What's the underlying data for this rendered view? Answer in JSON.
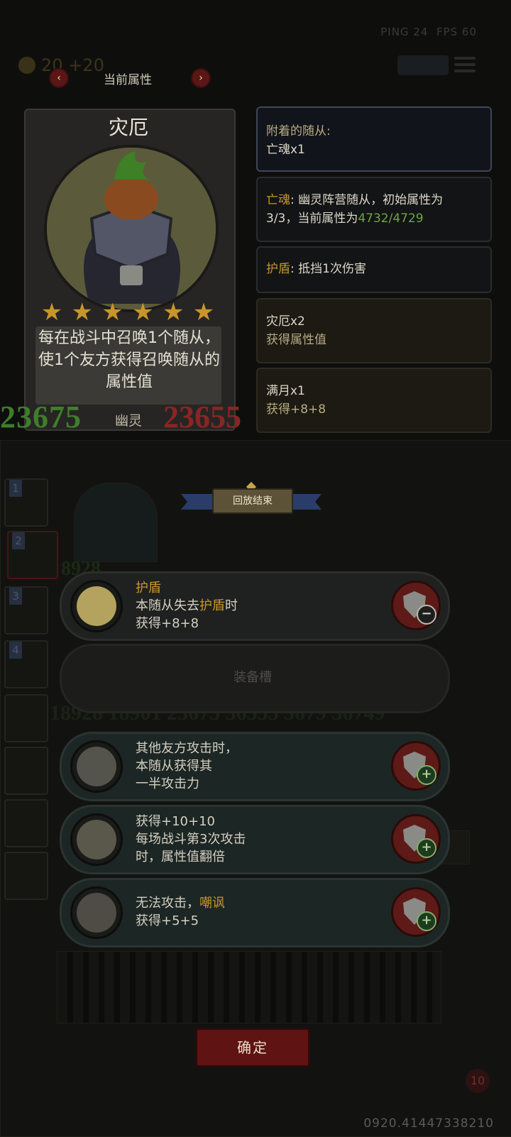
{
  "status": {
    "ping": "PING 24",
    "fps": "FPS 60",
    "gold": "20",
    "gold_income": "+20"
  },
  "attr_header": {
    "title": "当前属性",
    "prev": "‹",
    "next": "›"
  },
  "card": {
    "name": "灾厄",
    "stars": 6,
    "description": "每在战斗中召唤1个随从，使1个友方获得召唤随从的属性值",
    "attack": "23675",
    "health": "23655",
    "tribe": "幽灵"
  },
  "panels": {
    "attached_label": "附着的随从:",
    "attached_value": "亡魂x1",
    "ghost_name": "亡魂",
    "ghost_desc_a": ": 幽灵阵营随从，初始属性为",
    "ghost_desc_b": "3/3，当前属性为",
    "ghost_stats": "4732/4729",
    "shield_name": "护盾",
    "shield_desc": ": 抵挡1次伤害",
    "disaster_title": "灾厄x2",
    "disaster_sub": "获得属性值",
    "fullmoon_title": "满月x1",
    "fullmoon_sub": "获得+8+8"
  },
  "replay_banner": "回放结束",
  "left_slots": [
    "1",
    "2",
    "3",
    "4"
  ],
  "equipment": {
    "row1": {
      "title": "护盾",
      "line1a": "本随从失去",
      "line1b": "护盾",
      "line1c": "时",
      "line2": "获得+8+8"
    },
    "empty_slot": "装备槽",
    "row2": {
      "line1": "其他友方攻击时，",
      "line2": "本随从获得其",
      "line3": "一半攻击力"
    },
    "row3": {
      "line1": "获得+10+10",
      "line2": "每场战斗第3次攻击",
      "line3": "时，属性值翻倍"
    },
    "row4": {
      "line1a": "无法攻击，",
      "line1b": "嘲讽",
      "line2": "获得+5+5"
    }
  },
  "buttons": {
    "remove": "−",
    "add": "+",
    "confirm": "确定"
  },
  "footer": {
    "code": "0920.41447338210",
    "lives": "10"
  },
  "colors": {
    "gold": "#c9952a",
    "attack_green": "#3f7d2b",
    "health_red": "#8b2424",
    "button_red": "#5f1313"
  },
  "icons": [
    "menu-icon",
    "speed-icon",
    "coin-icon",
    "shield-remove-icon",
    "shield-add-icon",
    "star-icon",
    "lock-icon"
  ]
}
